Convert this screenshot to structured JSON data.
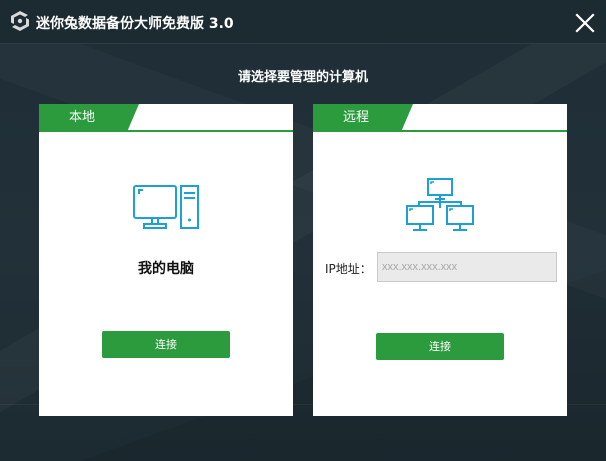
{
  "window": {
    "title": "迷你兔数据备份大师免费版 3.0"
  },
  "prompt": "请选择要管理的计算机",
  "local_card": {
    "tab_label": "本地",
    "computer_label": "我的电脑",
    "connect_label": "连接"
  },
  "remote_card": {
    "tab_label": "远程",
    "ip_label": "IP地址：",
    "ip_placeholder": "xxx.xxx.xxx.xxx",
    "connect_label": "连接"
  },
  "icons": {
    "logo": "app-logo-icon",
    "close": "close-icon",
    "local": "computer-icon",
    "remote": "network-icon"
  },
  "colors": {
    "accent": "#2b9b3e",
    "icon": "#1e9fd6",
    "background": "#1f2e36"
  }
}
